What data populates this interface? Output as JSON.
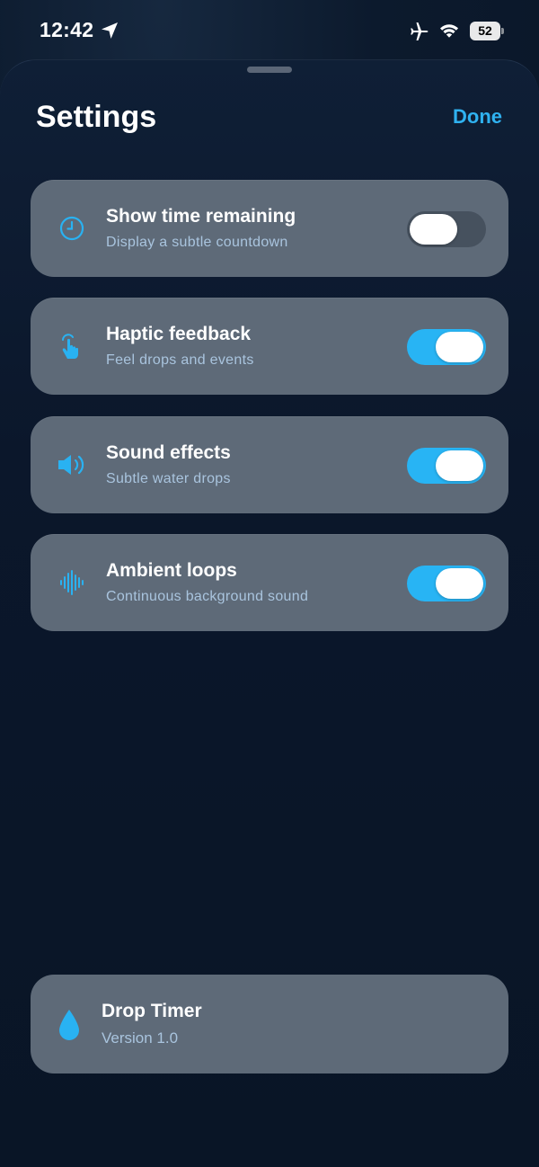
{
  "status_bar": {
    "time": "12:42",
    "battery": "52",
    "icons": [
      "location-arrow-icon",
      "airplane-icon",
      "wifi-icon",
      "battery-icon"
    ]
  },
  "header": {
    "title": "Settings",
    "done_label": "Done"
  },
  "settings": [
    {
      "icon": "clock-icon",
      "label": "Show time remaining",
      "subtitle": "Display a subtle countdown",
      "enabled": false
    },
    {
      "icon": "tap-hand-icon",
      "label": "Haptic feedback",
      "subtitle": "Feel drops and events",
      "enabled": true
    },
    {
      "icon": "speaker-icon",
      "label": "Sound effects",
      "subtitle": "Subtle water drops",
      "enabled": true
    },
    {
      "icon": "waveform-icon",
      "label": "Ambient loops",
      "subtitle": "Continuous background sound",
      "enabled": true
    }
  ],
  "about": {
    "icon": "water-drop-icon",
    "app_name": "Drop Timer",
    "version": "Version 1.0"
  },
  "colors": {
    "accent": "#28b4f4",
    "done": "#2fb2f0",
    "card": "#5e6a78",
    "background": "#0c1a2d",
    "toggle_off": "#46515e"
  }
}
